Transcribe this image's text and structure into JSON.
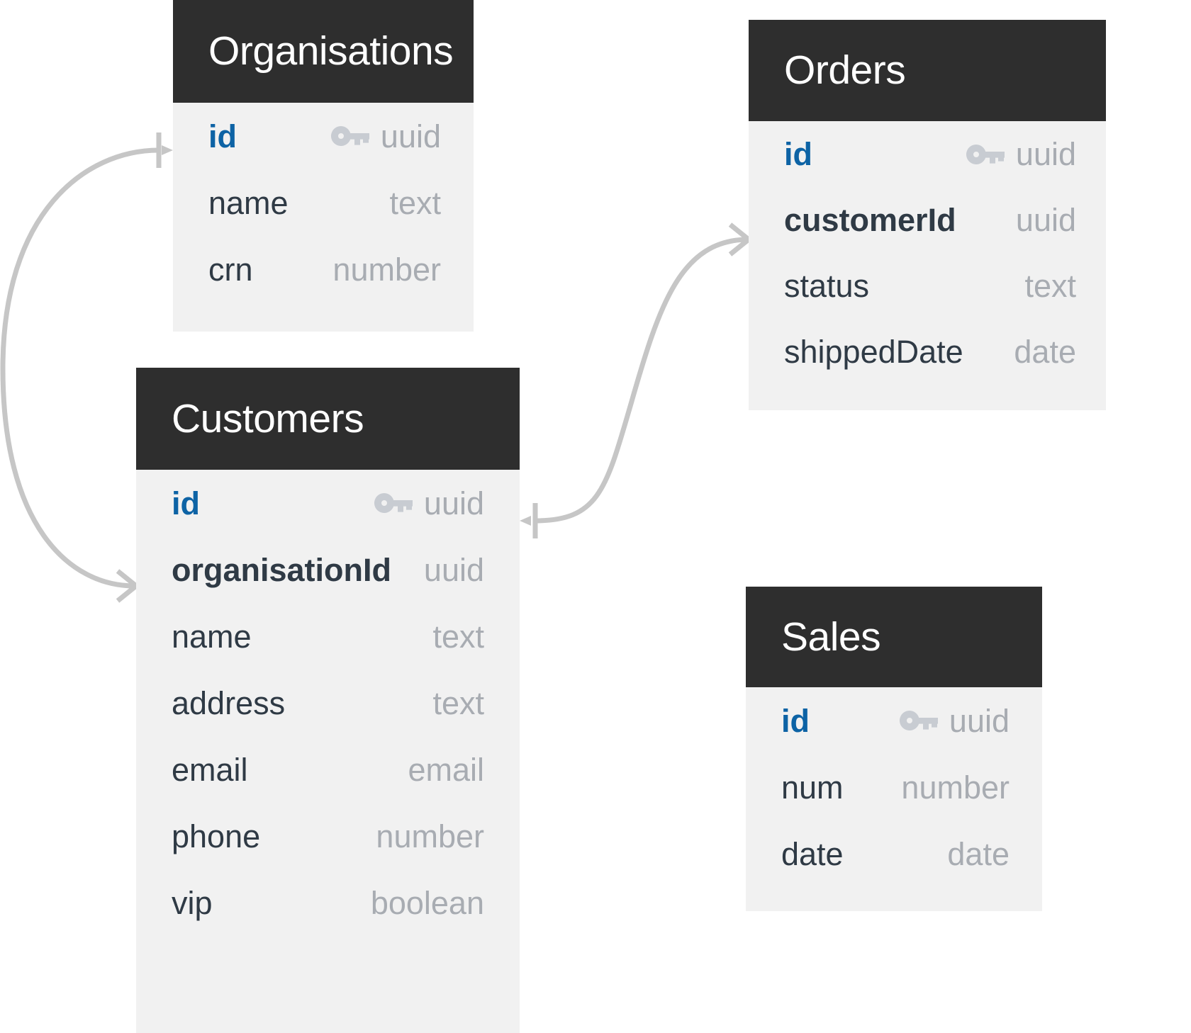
{
  "diagram": {
    "type": "entity-relationship-diagram",
    "background_color": "#ffffff",
    "header_color": "#2e2e2e",
    "body_color": "#f1f1f1",
    "pk_color": "#0d63a5",
    "type_color": "#a8acb2",
    "field_color": "#2f3a45",
    "edge_color": "#c6c6c6"
  },
  "entities": [
    {
      "name": "Organisations",
      "fields": [
        {
          "name": "id",
          "type": "uuid",
          "key": true,
          "foreign": false,
          "icon": "key-icon"
        },
        {
          "name": "name",
          "type": "text",
          "key": false,
          "foreign": false
        },
        {
          "name": "crn",
          "type": "number",
          "key": false,
          "foreign": false
        }
      ]
    },
    {
      "name": "Customers",
      "fields": [
        {
          "name": "id",
          "type": "uuid",
          "key": true,
          "foreign": false,
          "icon": "key-icon"
        },
        {
          "name": "organisationId",
          "type": "uuid",
          "key": false,
          "foreign": true
        },
        {
          "name": "name",
          "type": "text",
          "key": false,
          "foreign": false
        },
        {
          "name": "address",
          "type": "text",
          "key": false,
          "foreign": false
        },
        {
          "name": "email",
          "type": "email",
          "key": false,
          "foreign": false
        },
        {
          "name": "phone",
          "type": "number",
          "key": false,
          "foreign": false
        },
        {
          "name": "vip",
          "type": "boolean",
          "key": false,
          "foreign": false
        }
      ]
    },
    {
      "name": "Orders",
      "fields": [
        {
          "name": "id",
          "type": "uuid",
          "key": true,
          "foreign": false,
          "icon": "key-icon"
        },
        {
          "name": "customerId",
          "type": "uuid",
          "key": false,
          "foreign": true
        },
        {
          "name": "status",
          "type": "text",
          "key": false,
          "foreign": false
        },
        {
          "name": "shippedDate",
          "type": "date",
          "key": false,
          "foreign": false
        }
      ]
    },
    {
      "name": "Sales",
      "fields": [
        {
          "name": "id",
          "type": "uuid",
          "key": true,
          "foreign": false,
          "icon": "key-icon"
        },
        {
          "name": "num",
          "type": "number",
          "key": false,
          "foreign": false
        },
        {
          "name": "date",
          "type": "date",
          "key": false,
          "foreign": false
        }
      ]
    }
  ],
  "relationships": [
    {
      "from": "Organisations.id",
      "to": "Customers.organisationId",
      "from_cardinality": "one",
      "to_cardinality": "many"
    },
    {
      "from": "Customers.id",
      "to": "Orders.customerId",
      "from_cardinality": "one",
      "to_cardinality": "many"
    }
  ]
}
